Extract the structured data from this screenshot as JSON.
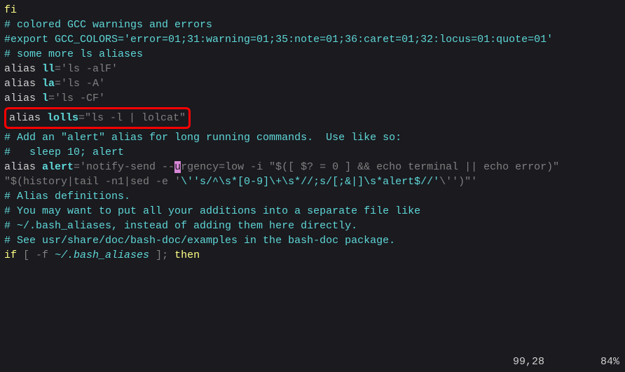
{
  "lines": {
    "fi": "fi",
    "blank": "",
    "comment_gcc": "# colored GCC warnings and errors",
    "comment_export": "#export GCC_COLORS='error=01;31:warning=01;35:note=01;36:caret=01;32:locus=01:quote=01'",
    "comment_more": "# some more ls aliases",
    "alias_kw": "alias",
    "ll_name": " ll",
    "ll_val": "='ls -alF'",
    "la_name": " la",
    "la_val": "='ls -A'",
    "l_name": " l",
    "l_val": "='ls -CF'",
    "lolls_name": " lolls",
    "lolls_val": "=\"ls -l | lolcat\"",
    "comment_alert1": "# Add an \"alert\" alias for long running commands.  Use like so:",
    "comment_alert2": "#   sleep 10; alert",
    "alert_name": " alert",
    "alert_eq": "='notify-send --",
    "alert_cursor": "u",
    "alert_rest": "rgency=low -i \"$([ $? = 0 ] && echo terminal || echo error)\" ",
    "alert_line2a": "\"$(history|tail -n1|sed -e '",
    "alert_line2b": "\\''s/^\\s*[0-9]\\+\\s*//;s/[;&|]\\s*alert$//'",
    "alert_line2c": "\\''",
    "alert_line2d": ")\"'",
    "comment_def1": "# Alias definitions.",
    "comment_def2": "# You may want to put all your additions into a separate file like",
    "comment_def3": "# ~/.bash_aliases, instead of adding them here directly.",
    "comment_def4": "# See usr/share/doc/bash-doc/examples in the bash-doc package.",
    "if_kw": "if",
    "if_test": " [ -f ",
    "if_path": "~/.bash_aliases",
    "if_end": " ]; ",
    "then_kw": "then"
  },
  "status": {
    "pos": "99,28",
    "pct": "84%"
  }
}
